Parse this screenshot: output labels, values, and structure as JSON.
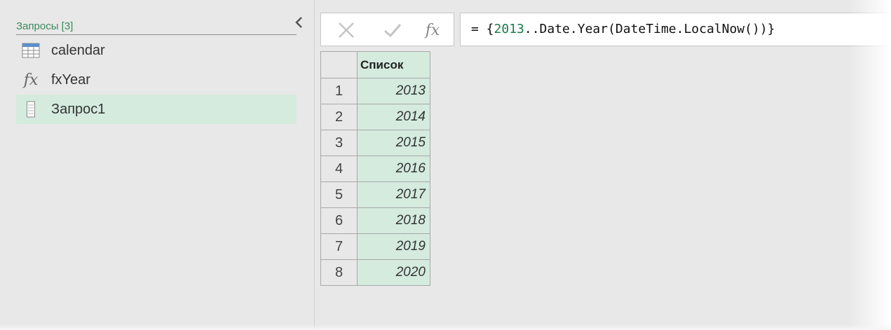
{
  "queries": {
    "title": "Запросы [3]",
    "items": [
      {
        "label": "calendar",
        "icon": "table-icon",
        "selected": false
      },
      {
        "label": "fxYear",
        "icon": "function-icon",
        "selected": false
      },
      {
        "label": "Запрос1",
        "icon": "list-icon",
        "selected": true
      }
    ]
  },
  "formula_bar": {
    "fx_label": "fx",
    "formula_prefix": "= {",
    "formula_number": "2013",
    "formula_suffix": "..Date.Year(DateTime.LocalNow())}"
  },
  "table": {
    "column_header": "Список",
    "rows": [
      {
        "index": "1",
        "value": "2013"
      },
      {
        "index": "2",
        "value": "2014"
      },
      {
        "index": "3",
        "value": "2015"
      },
      {
        "index": "4",
        "value": "2016"
      },
      {
        "index": "5",
        "value": "2017"
      },
      {
        "index": "6",
        "value": "2018"
      },
      {
        "index": "7",
        "value": "2019"
      },
      {
        "index": "8",
        "value": "2020"
      }
    ]
  },
  "colors": {
    "accent_green": "#3b8a5c",
    "selected_bg": "#d4ebde",
    "pane_bg": "#e8e8e8"
  }
}
